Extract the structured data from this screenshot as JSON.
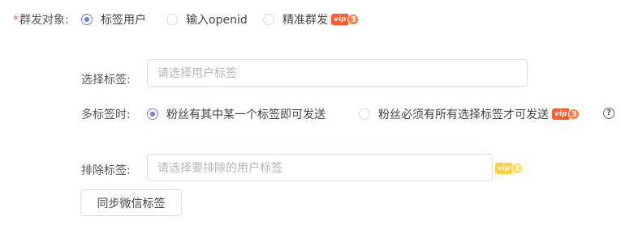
{
  "send_target": {
    "required_mark": "*",
    "label": "群发对象:",
    "options": [
      {
        "label": "标签用户",
        "checked": true
      },
      {
        "label": "输入openid",
        "checked": false
      },
      {
        "label": "精准群发",
        "checked": false
      }
    ],
    "vip": {
      "text": "vip",
      "level": "3"
    }
  },
  "select_tags": {
    "label": "选择标签:",
    "placeholder": "请选择用户标签"
  },
  "multi_tags": {
    "label": "多标签时:",
    "options": [
      {
        "label": "粉丝有其中某一个标签即可发送",
        "checked": true
      },
      {
        "label": "粉丝必须有所有选择标签才可发送",
        "checked": false
      }
    ],
    "vip": {
      "text": "vip",
      "level": "3"
    },
    "help_icon": "?"
  },
  "exclude_tags": {
    "label": "排除标签:",
    "placeholder": "请选择要排除的用户标签",
    "vip": {
      "text": "vip",
      "level": "1"
    }
  },
  "sync_button": {
    "label": "同步微信标签"
  },
  "colors": {
    "accent": "#6b7cf6",
    "vip_red": "#ff5a2c",
    "vip_yellow": "#ffcf3d",
    "required": "#ff4d4f"
  }
}
